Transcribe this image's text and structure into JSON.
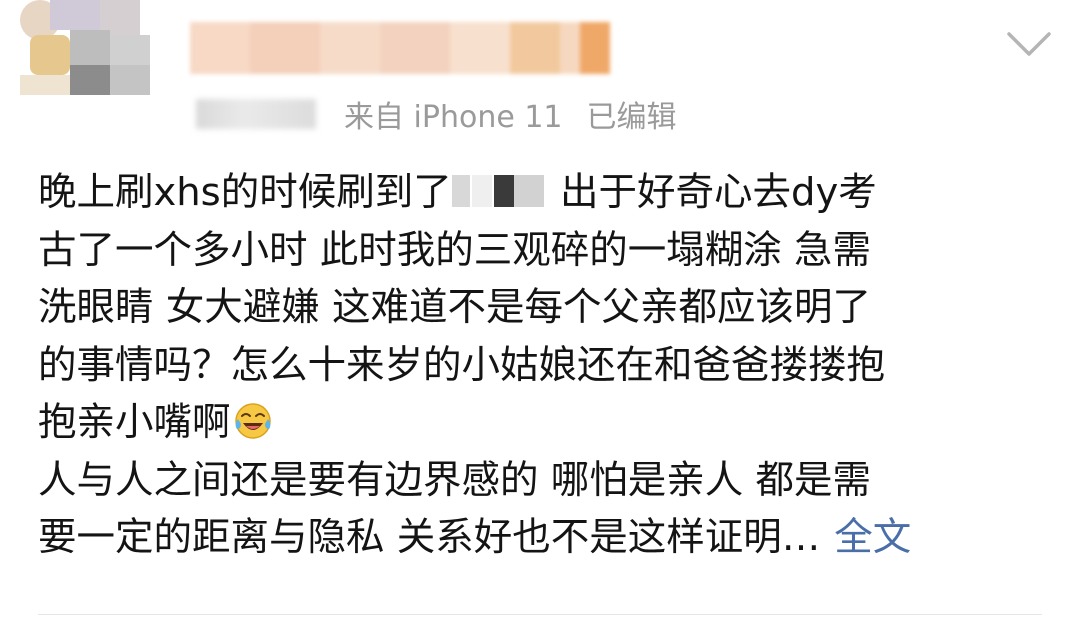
{
  "meta": {
    "source": "来自 iPhone 11",
    "edited": "已编辑"
  },
  "post": {
    "line1_before": "晚上刷xhs的时候刷到了",
    "line1_after": "出于好奇心去dy考",
    "line2": "古了一个多小时 此时我的三观碎的一塌糊涂 急需",
    "line3": "洗眼睛 女大避嫌 这难道不是每个父亲都应该明了",
    "line4": "的事情吗？怎么十来岁的小姑娘还在和爸爸搂搂抱",
    "line5": "抱亲小嘴啊",
    "line6": "人与人之间还是要有边界感的 哪怕是亲人 都是需",
    "line7": "要一定的距离与隐私 关系好也不是这样证明…",
    "expand_label": "全文",
    "emoji": "laughing-crying-emoji"
  },
  "icons": {
    "chevron": "chevron-down-icon"
  }
}
